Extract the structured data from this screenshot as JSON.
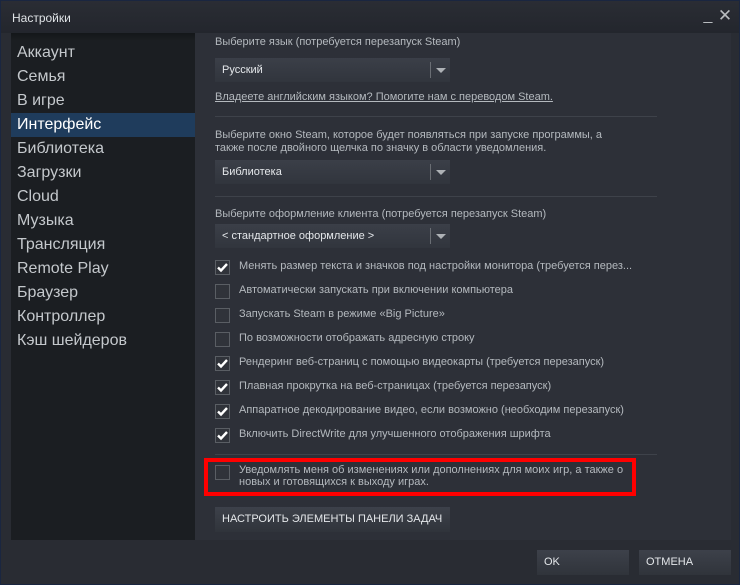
{
  "window": {
    "title": "Настройки",
    "minimize_label": "_",
    "close_label": "✕"
  },
  "sidebar": {
    "active": "Интерфейс",
    "items": [
      {
        "label": "Аккаунт"
      },
      {
        "label": "Семья"
      },
      {
        "label": "В игре"
      },
      {
        "label": "Интерфейс"
      },
      {
        "label": "Библиотека"
      },
      {
        "label": "Загрузки"
      },
      {
        "label": "Cloud"
      },
      {
        "label": "Музыка"
      },
      {
        "label": "Трансляция"
      },
      {
        "label": "Remote Play"
      },
      {
        "label": "Браузер"
      },
      {
        "label": "Контроллер"
      },
      {
        "label": "Кэш шейдеров"
      }
    ]
  },
  "content": {
    "language": {
      "label": "Выберите язык (потребуется перезапуск Steam)",
      "value": "Русский",
      "link": "Владеете английским языком? Помогите нам с переводом Steam."
    },
    "start_window": {
      "label_line1": "Выберите окно Steam, которое будет появляться при запуске программы, а",
      "label_line2": "также после двойного щелчка по значку в области уведомления.",
      "value": "Библиотека"
    },
    "skin": {
      "label": "Выберите оформление клиента (потребуется перезапуск Steam)",
      "value": "< стандартное оформление >"
    },
    "checkboxes": [
      {
        "label": "Менять размер текста и значков под настройки монитора (требуется перез...",
        "checked": true
      },
      {
        "label": "Автоматически запускать при включении компьютера",
        "checked": false
      },
      {
        "label": "Запускать Steam в режиме «Big Picture»",
        "checked": false
      },
      {
        "label": "По возможности отображать адресную строку",
        "checked": false
      },
      {
        "label": "Рендеринг веб-страниц с помощью видеокарты (требуется перезапуск)",
        "checked": true
      },
      {
        "label": "Плавная прокрутка на веб-страницах (требуется перезапуск)",
        "checked": true
      },
      {
        "label": "Аппаратное декодирование видео, если возможно (необходим перезапуск)",
        "checked": true
      },
      {
        "label": "Включить DirectWrite для улучшенного отображения шрифта",
        "checked": true
      }
    ],
    "notify": {
      "label": "Уведомлять меня об изменениях или дополнениях для моих игр, а также о новых и готовящихся к выходу играх.",
      "checked": false,
      "highlight_color": "#ff0000"
    },
    "taskbar_button": "НАСТРОИТЬ ЭЛЕМЕНТЫ ПАНЕЛИ ЗАДАЧ"
  },
  "footer": {
    "ok": "OK",
    "cancel": "ОТМЕНА"
  }
}
